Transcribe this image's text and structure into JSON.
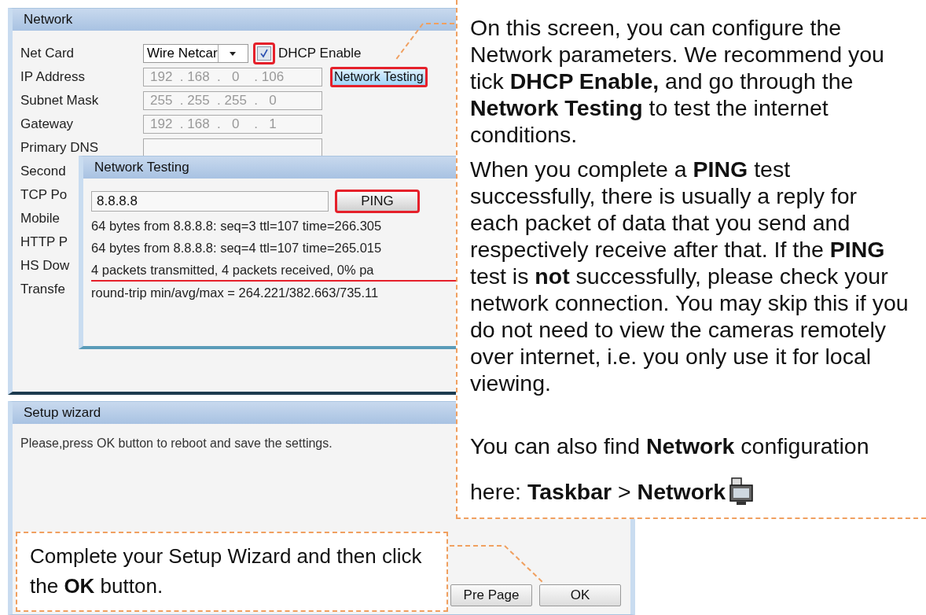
{
  "network_window": {
    "title": "Network",
    "rows": [
      {
        "kind": "select",
        "label": "Net Card",
        "value": "Wire Netcar",
        "checkbox": {
          "label": "DHCP Enable",
          "checked": true
        }
      },
      {
        "kind": "ip",
        "label": "IP Address",
        "value": "192  . 168  .   0    . 106",
        "disabled": true,
        "button": "Network Testing"
      },
      {
        "kind": "ip",
        "label": "Subnet Mask",
        "value": "255  . 255  . 255  .   0",
        "disabled": true,
        "button": null
      },
      {
        "kind": "ip",
        "label": "Gateway",
        "value": "192  . 168  .   0    .   1",
        "disabled": true,
        "button": null
      },
      {
        "kind": "covered",
        "label": "Primary DNS"
      },
      {
        "kind": "label",
        "label": "Second"
      },
      {
        "kind": "label",
        "label": "TCP Po"
      },
      {
        "kind": "label",
        "label": "Mobile"
      },
      {
        "kind": "label",
        "label": "HTTP P"
      },
      {
        "kind": "label",
        "label": "HS Dow"
      },
      {
        "kind": "label",
        "label": "Transfe"
      }
    ]
  },
  "testing_dialog": {
    "title": "Network Testing",
    "address": "8.8.8.8",
    "button": "PING",
    "output": [
      {
        "text": "64 bytes from 8.8.8.8: seq=3 ttl=107 time=266.305",
        "underlined": false
      },
      {
        "text": "64 bytes from 8.8.8.8: seq=4 ttl=107 time=265.015",
        "underlined": false
      },
      {
        "text": "4 packets transmitted, 4 packets received, 0% pa",
        "underlined": true
      },
      {
        "text": "round-trip min/avg/max = 264.221/382.663/735.11",
        "underlined": false
      }
    ]
  },
  "setup_window": {
    "title": "Setup wizard",
    "message": "Please,press OK button to reboot and save the settings.",
    "buttons": [
      "Pre Page",
      "OK"
    ]
  },
  "callout_right": {
    "paragraphs": [
      "On this screen, you can configure the Network parameters. We recommend you tick **DHCP Enable,** and go through the **Network Testing** to test the internet conditions.",
      "When you complete a **PING** test successfully, there is usually a reply for each packet of data that you send and respectively receive after that. If the **PING** test is **not** successfully, please check your network connection. You may skip this if you do not need to view the cameras remotely over internet, i.e. you only use it for local viewing."
    ],
    "footer_lines": [
      "You can also find **Network** configuration",
      "here: **Taskbar** > **Network**"
    ]
  },
  "callout_bottom": {
    "text": "Complete your Setup Wizard and then click the **OK** button."
  }
}
